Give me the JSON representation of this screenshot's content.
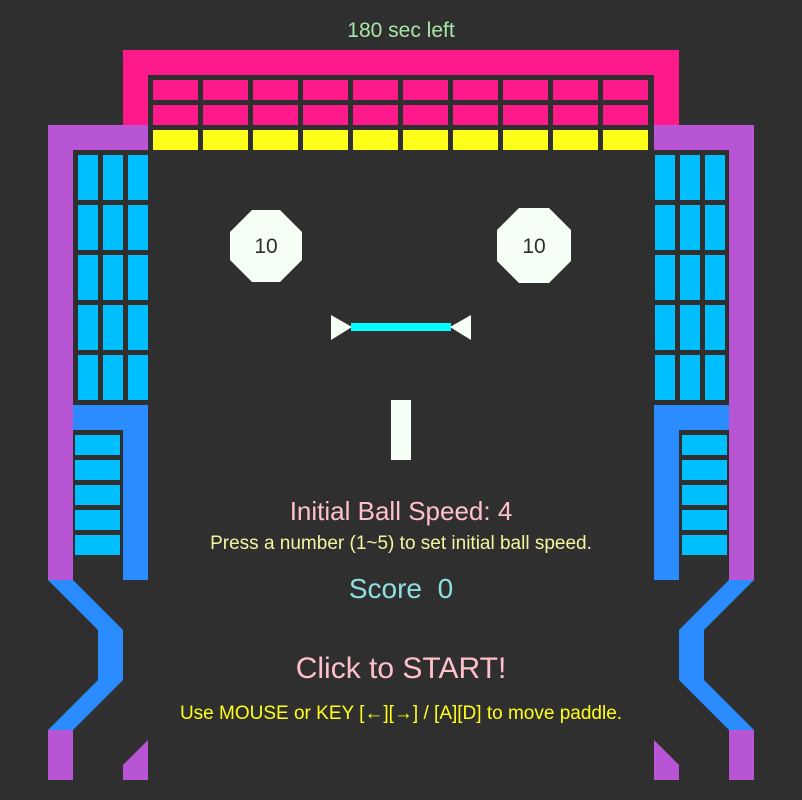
{
  "timer": {
    "text": "180 sec left"
  },
  "bumpers": {
    "left_value": "10",
    "right_value": "10"
  },
  "speed": {
    "label": "Initial Ball Speed: 4",
    "hint": "Press a number (1~5) to set initial ball speed."
  },
  "score": {
    "label": "Score  0"
  },
  "start": {
    "label": "Click to START!"
  },
  "instructions": {
    "text": "Use MOUSE or KEY [←][→] / [A][D] to move paddle."
  },
  "colors": {
    "background": "#2f2f2f",
    "top_wall": "#ff1a8c",
    "side_wall": "#b855d4",
    "inner_wall": "#2b8cff",
    "brick_pink": "#ff1a8c",
    "brick_yellow": "#ffff1a",
    "brick_blue": "#00bfff",
    "paddle": "#00ffff",
    "white": "#f5fff5",
    "timer_text": "#a8e6a8",
    "speed_text": "#ffc0cb",
    "hint_text": "#f5f5a0",
    "score_text": "#8ee0e0",
    "start_text": "#ffc0cb",
    "instruction_text": "#ffff1a"
  }
}
